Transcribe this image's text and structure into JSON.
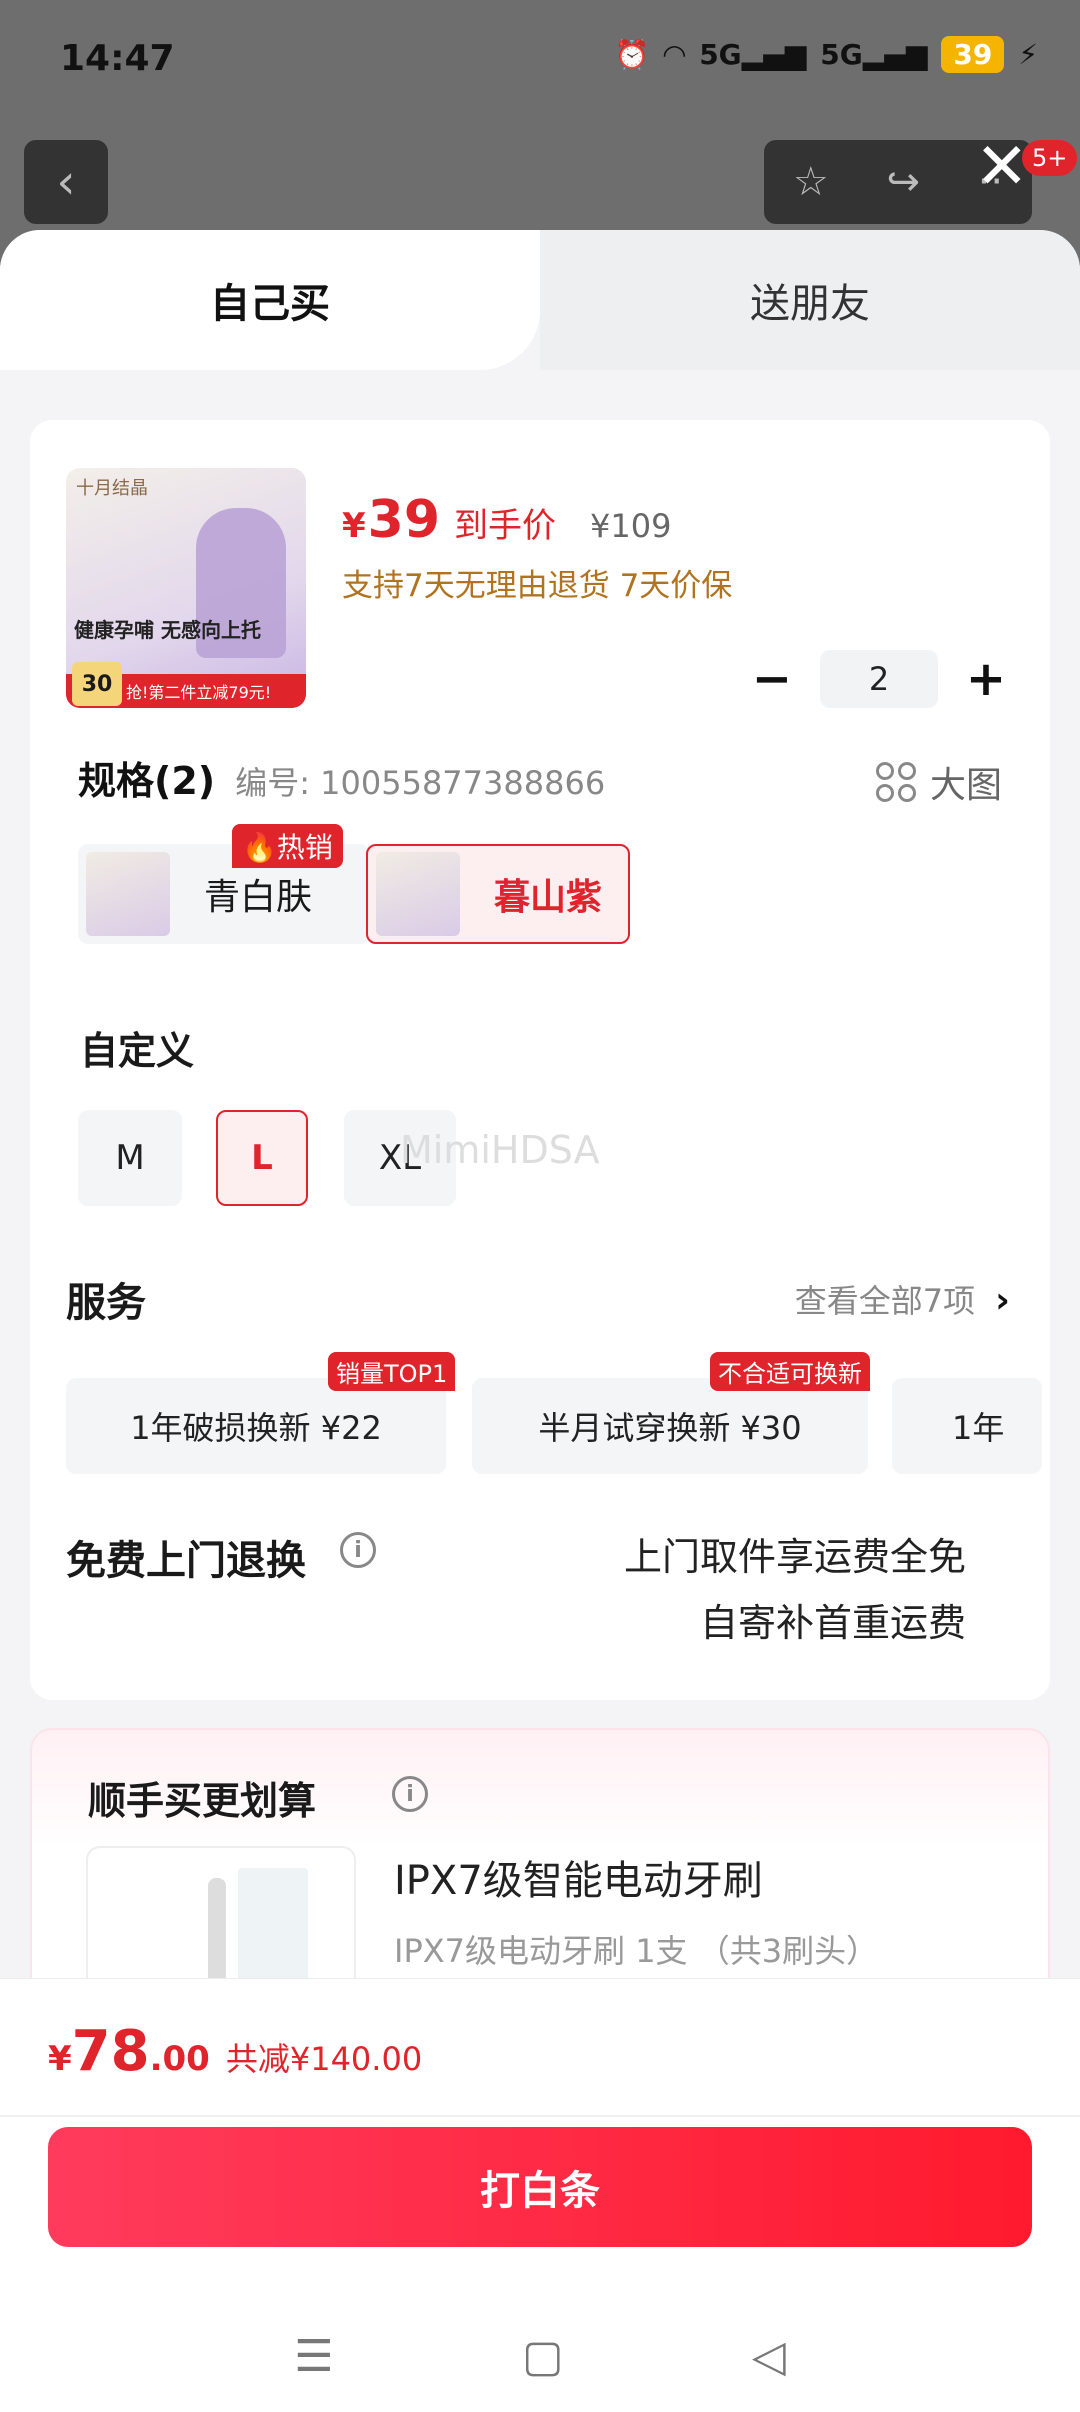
{
  "status_bar": {
    "time": "14:47",
    "alarm_icon": "alarm-icon",
    "wifi_icon": "wifi-icon",
    "signal1": "5G",
    "signal2": "5G",
    "battery": "39"
  },
  "top_nav": {
    "badge": "5+"
  },
  "tabs": [
    {
      "label": "自己买",
      "active": true
    },
    {
      "label": "送朋友",
      "active": false
    }
  ],
  "product": {
    "thumb": {
      "brand": "十月结晶",
      "tagline": "健康孕哺 无感向上托",
      "promo": "抢!第二件立减79元!",
      "price_badge": "30"
    },
    "price_symbol": "¥",
    "price": "39",
    "price_label": "到手价",
    "original_price": "¥109",
    "guarantee": "支持7天无理由退货 7天价保",
    "quantity": "2",
    "minus": "−",
    "plus": "+"
  },
  "spec": {
    "title": "规格(2)",
    "code": "编号: 10055877388866",
    "big_picture": "大图",
    "hot_tag": "热销",
    "variants": [
      {
        "label": "青白肤",
        "selected": false
      },
      {
        "label": "暮山紫",
        "selected": true
      }
    ]
  },
  "custom": {
    "title": "自定义",
    "sizes": [
      {
        "label": "M",
        "selected": false
      },
      {
        "label": "L",
        "selected": true
      },
      {
        "label": "XL",
        "selected": false
      }
    ],
    "watermark": "MimiHDSA"
  },
  "service": {
    "title": "服务",
    "view_all": "查看全部7项",
    "chevron": "›",
    "items": [
      {
        "label": "1年破损换新  ¥22",
        "tag": "销量TOP1"
      },
      {
        "label": "半月试穿换新  ¥30",
        "tag": "不合适可换新"
      },
      {
        "label": "1年",
        "tag": ""
      }
    ]
  },
  "return": {
    "title": "免费上门退换",
    "info": "i",
    "line1": "上门取件享运费全免",
    "line2": "自寄补首重运费"
  },
  "bundle": {
    "title": "顺手买更划算",
    "info": "i",
    "name": "IPX7级智能电动牙刷",
    "desc": "IPX7级电动牙刷 1支 （共3刷头）"
  },
  "footer": {
    "symbol": "¥",
    "total_int": "78",
    "total_dec": ".00",
    "saved": "共减¥140.00",
    "buy_label": "打白条"
  },
  "colors": {
    "accent": "#e0242c",
    "guarantee": "#b0731f"
  }
}
